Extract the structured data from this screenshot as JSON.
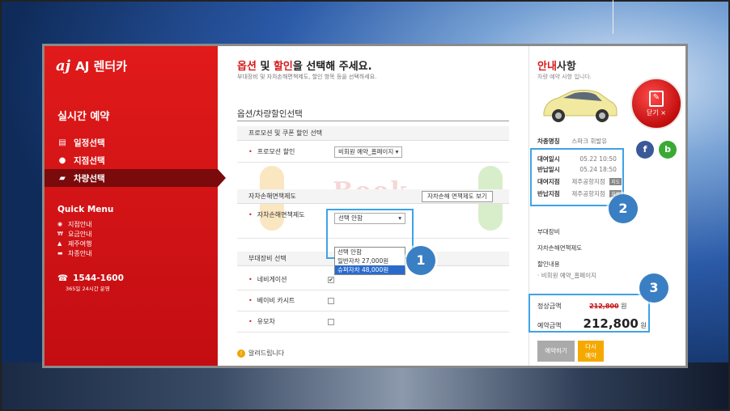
{
  "colors": {
    "brand_red": "#d81b1b",
    "sidebar_red": "#c30d12",
    "highlight_blue": "#3ea3e6",
    "marker_blue": "#3a7fc3",
    "button_orange": "#f5a900"
  },
  "brand": {
    "logo_mark": "aj",
    "name": "AJ 렌터카"
  },
  "sidebar": {
    "title": "실시간 예약",
    "steps": [
      {
        "icon": "calendar-icon",
        "label": "일정선택"
      },
      {
        "icon": "map-pin-icon",
        "label": "지점선택"
      },
      {
        "icon": "car-icon",
        "label": "차량선택"
      }
    ],
    "quick_menu_title": "Quick Menu",
    "quick_menu": [
      {
        "icon": "location-icon",
        "label": "지점안내"
      },
      {
        "icon": "won-icon",
        "label": "요금안내"
      },
      {
        "icon": "island-icon",
        "label": "제주여행"
      },
      {
        "icon": "car-small-icon",
        "label": "차종안내"
      }
    ],
    "phone": "1544-1600",
    "phone_sub": "365일 24시간 운영"
  },
  "main": {
    "title_hl1": "옵션",
    "title_mid": " 및 ",
    "title_hl2": "할인",
    "title_rest": "을 선택해 주세요.",
    "subtitle": "부대장비 및 자차손해면책제도, 할인 항목 등을 선택하세요.",
    "section_title": "옵션/차량할인선택",
    "promo_head": "프로모션 및 쿠폰 할인 선택",
    "promo_label": "프로모션 할인",
    "promo_value": "비회원 예약_홈페이지 ▾",
    "cdw_head": "자차손해면책제도",
    "cdw_button": "자차손해 면책제도 보기",
    "cdw_label": "자차손해면책제도",
    "cdw_select": "선택 안함",
    "cdw_options": [
      "선택 안함",
      "일반자차 27,000원",
      "슈퍼자차 48,000원"
    ],
    "equip_head": "부대장비 선택",
    "equip": [
      {
        "label": "네비게이션",
        "checked": "✔"
      },
      {
        "label": "베이비 카시트",
        "checked": ""
      },
      {
        "label": "유모차",
        "checked": ""
      }
    ],
    "notice": "알려드립니다",
    "watermark": "Book"
  },
  "right": {
    "title_hl": "안내",
    "title_rest": "사항",
    "subtitle": "차량 예약 사항 입니다.",
    "car_label": "차종명칭",
    "car_value": "스파크 휘발유",
    "rent_date_label": "대여일시",
    "rent_date": "05.22 10:50",
    "return_date_label": "반납일시",
    "return_date": "05.24 18:50",
    "rent_branch_label": "대여지점",
    "rent_branch": "제주공항지점",
    "return_branch_label": "반납지점",
    "return_branch": "제주공항지점",
    "branch_tag": "지도",
    "equip_label": "부대장비",
    "cdw_label": "자차손해면책제도",
    "discount_label": "할인내용",
    "discount_value": "· 비회원 예약_홈페이지",
    "normal_price_label": "정상금액",
    "normal_price": "212,800",
    "reserve_price_label": "예약금액",
    "reserve_price": "212,800",
    "won": "원",
    "btn_reserve": "예약하기",
    "btn_again_1": "다시",
    "btn_again_2": "예약",
    "close_label": "닫기 ×"
  },
  "markers": [
    "1",
    "2",
    "3"
  ],
  "social": {
    "facebook": "f",
    "blog": "b"
  }
}
